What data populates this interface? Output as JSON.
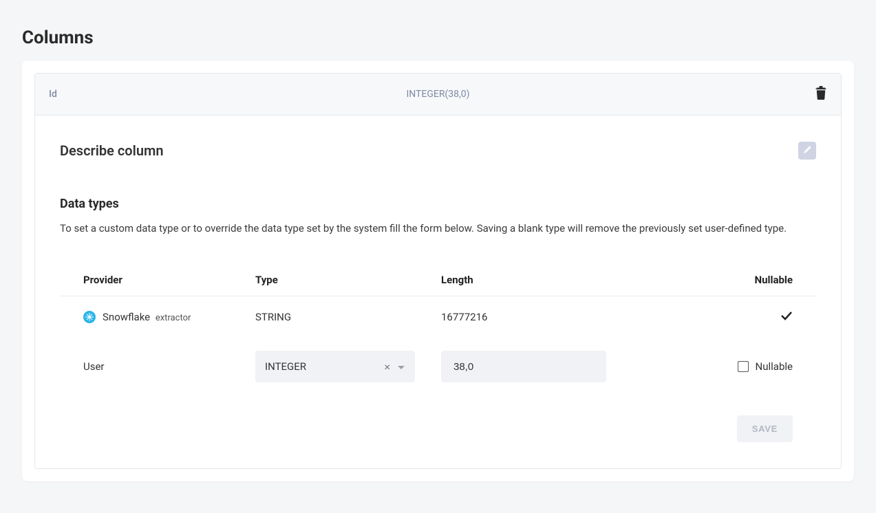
{
  "page": {
    "title": "Columns"
  },
  "column": {
    "name": "Id",
    "datatype_summary": "INTEGER(38,0)"
  },
  "describe": {
    "heading": "Describe column"
  },
  "datatypes": {
    "heading": "Data types",
    "helptext": "To set a custom data type or to override the data type set by the system fill the form below. Saving a blank type will remove the previously set user-defined type.",
    "headers": {
      "provider": "Provider",
      "type": "Type",
      "length": "Length",
      "nullable": "Nullable"
    },
    "rows": {
      "system": {
        "provider_name": "Snowflake",
        "provider_suffix": "extractor",
        "type": "STRING",
        "length": "16777216",
        "nullable": true
      },
      "user": {
        "provider_label": "User",
        "type_selected": "INTEGER",
        "length_value": "38,0",
        "nullable_label": "Nullable",
        "nullable_checked": false
      }
    },
    "save_label": "SAVE"
  }
}
